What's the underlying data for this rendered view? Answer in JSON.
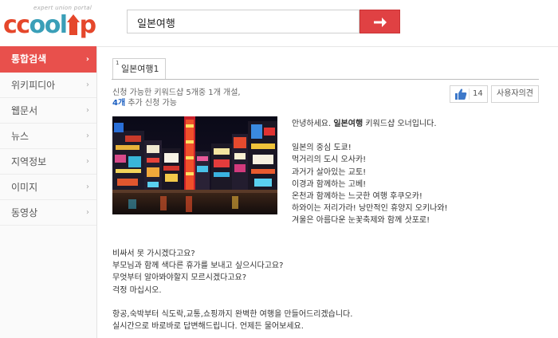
{
  "header": {
    "logo_tagline": "expert union portal",
    "logo_text_c1": "cc",
    "logo_text_mid": "ool",
    "logo_text_end": "p",
    "search_value": "일본여행",
    "search_button_icon": "arrow-right-icon"
  },
  "sidebar": {
    "items": [
      {
        "label": "통합검색",
        "active": true
      },
      {
        "label": "위키피디아"
      },
      {
        "label": "웹문서"
      },
      {
        "label": "뉴스"
      },
      {
        "label": "지역정보"
      },
      {
        "label": "이미지"
      },
      {
        "label": "동영상"
      }
    ],
    "chevron": "›"
  },
  "result": {
    "tab_number": "1",
    "tab_label": "일본여행1",
    "info_line1": "신청 가능한 키워드샵 5개중 1개 개설,",
    "info_line2_count": "4개",
    "info_line2_rest": " 추가 신청 가능",
    "like_count": "14",
    "opinion_label": "사용자의견",
    "intro_pre": "안녕하세요. ",
    "intro_bold": "일본여행",
    "intro_post": " 키워드샵 오너입니다.",
    "right_lines": [
      "일본의 중심 도쿄!",
      "먹거리의 도시 오사카!",
      "과거가 살아있는 교토!",
      "이경과 함께하는 고베!",
      "온천과 함께하는 느긋한 여행 후쿠오카!",
      "하와이는 저리가라! 낭만적인 휴양지 오키나와!",
      "겨울은 아름다운 눈꽃축제와 함께 삿포로!"
    ],
    "bottom_lines_1": [
      "비싸서 못 가시겠다고요?",
      "부모님과 함께 색다른 휴가를 보내고 싶으시다고요?",
      "무엇부터 알아봐야할지 모르시겠다고요?",
      "걱정 마십시오."
    ],
    "bottom_lines_2": [
      "항공,숙박부터 식도락,교통,쇼핑까지 완벽한 여행을 만들어드리겠습니다.",
      "실시간으로 바로바로 답변해드립니다. 언제든 물어보세요."
    ]
  },
  "colors": {
    "accent_red": "#e04143",
    "sidebar_active": "#e8504c",
    "link_blue": "#1b5fc1",
    "logo_teal": "#3a9fb8"
  }
}
